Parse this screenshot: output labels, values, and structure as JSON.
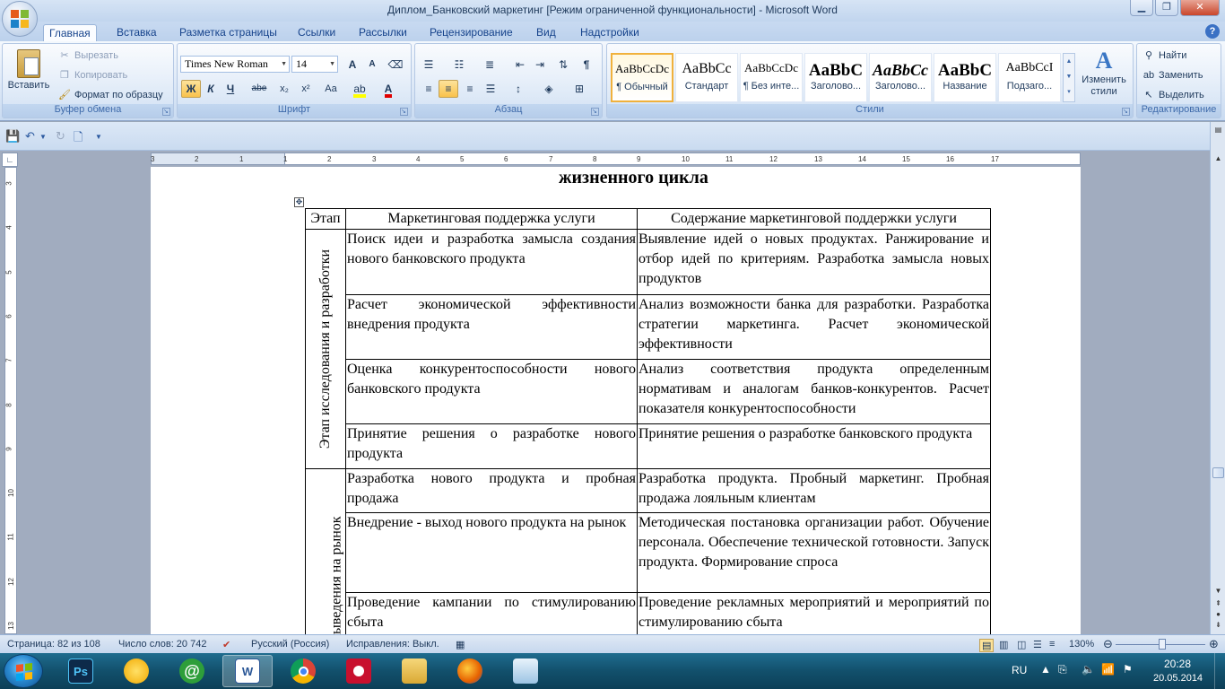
{
  "window": {
    "title": "Диплом_Банковский маркетинг [Режим ограниченной функциональности] - Microsoft Word",
    "minimize": "▁",
    "maximize": "❐",
    "close": "✕"
  },
  "tabs": [
    "Главная",
    "Вставка",
    "Разметка страницы",
    "Ссылки",
    "Рассылки",
    "Рецензирование",
    "Вид",
    "Надстройки"
  ],
  "clipboard": {
    "paste": "Вставить",
    "cut": "Вырезать",
    "copy": "Копировать",
    "format_painter": "Формат по образцу",
    "label": "Буфер обмена"
  },
  "font": {
    "name": "Times New Roman",
    "size": "14",
    "grow": "A",
    "shrink": "A",
    "bold": "Ж",
    "italic": "К",
    "underline": "Ч",
    "strike": "abe",
    "sub": "x₂",
    "sup": "x²",
    "case": "Aa",
    "label": "Шрифт"
  },
  "paragraph": {
    "label": "Абзац",
    "pilcrow": "¶"
  },
  "styles": {
    "items": [
      {
        "sample": "AaBbCcDc",
        "name": "¶ Обычный"
      },
      {
        "sample": "AaBbCc",
        "name": "Стандарт"
      },
      {
        "sample": "AaBbCcDc",
        "name": "¶ Без инте..."
      },
      {
        "sample": "AaBbC",
        "name": "Заголово..."
      },
      {
        "sample": "AaBbCc",
        "name": "Заголово..."
      },
      {
        "sample": "AaBbC",
        "name": "Название"
      },
      {
        "sample": "AaBbCcI",
        "name": "Подзаго..."
      }
    ],
    "change": "Изменить стили",
    "label": "Стили"
  },
  "editing": {
    "find": "Найти",
    "replace": "Заменить",
    "select": "Выделить",
    "label": "Редактирование"
  },
  "ruler_h": [
    "3",
    "2",
    "1",
    "1",
    "2",
    "3",
    "4",
    "5",
    "6",
    "7",
    "8",
    "9",
    "10",
    "11",
    "12",
    "13",
    "14",
    "15",
    "16",
    "17"
  ],
  "ruler_v": [
    "3",
    "4",
    "5",
    "6",
    "7",
    "8",
    "9",
    "10",
    "11",
    "12",
    "13"
  ],
  "document": {
    "heading_fragment": "жизненного цикла",
    "table": {
      "headers": [
        "Этап",
        "Маркетинговая поддержка услуги",
        "Содержание маркетинговой поддержки услуги"
      ],
      "stage1": "Этап исследования и разработки",
      "stage2": "выведения на рынок",
      "rows": [
        [
          "Поиск идеи и разработка замысла создания нового банковского продукта",
          "Выявление идей о новых продуктах. Ранжирование и отбор идей по критериям. Разработка замысла новых продуктов"
        ],
        [
          "Расчет экономической эффективности внедрения продукта",
          "Анализ возможности банка для разработки. Разработка стратегии маркетинга. Расчет экономической эффективности"
        ],
        [
          "Оценка конкурентоспособности нового банковского продукта",
          "Анализ соответствия продукта определенным нормативам и аналогам банков-конкурентов. Расчет показателя конкурентоспособности"
        ],
        [
          "Принятие решения о разработке нового продукта",
          "Принятие решения о разработке банковского продукта"
        ],
        [
          "Разработка нового продукта и пробная продажа",
          "Разработка продукта. Пробный маркетинг. Пробная продажа лояльным клиентам"
        ],
        [
          "Внедрение - выход нового продукта на рынок",
          "Методическая постановка организации работ. Обучение персонала. Обеспечение технической готовности. Запуск продукта. Формирование спроса"
        ],
        [
          "Проведение кампании по стимулированию сбыта",
          "Проведение рекламных мероприятий и мероприятий по стимулированию сбыта"
        ]
      ]
    }
  },
  "status": {
    "page": "Страница: 82 из 108",
    "words": "Число слов: 20 742",
    "language": "Русский (Россия)",
    "track": "Исправления: Выкл.",
    "zoom": "130%"
  },
  "taskbar": {
    "apps": [
      "Ps",
      "",
      "@",
      "W",
      "",
      "",
      "",
      "",
      ""
    ],
    "lang": "RU",
    "time": "20:28",
    "date": "20.05.2014"
  }
}
